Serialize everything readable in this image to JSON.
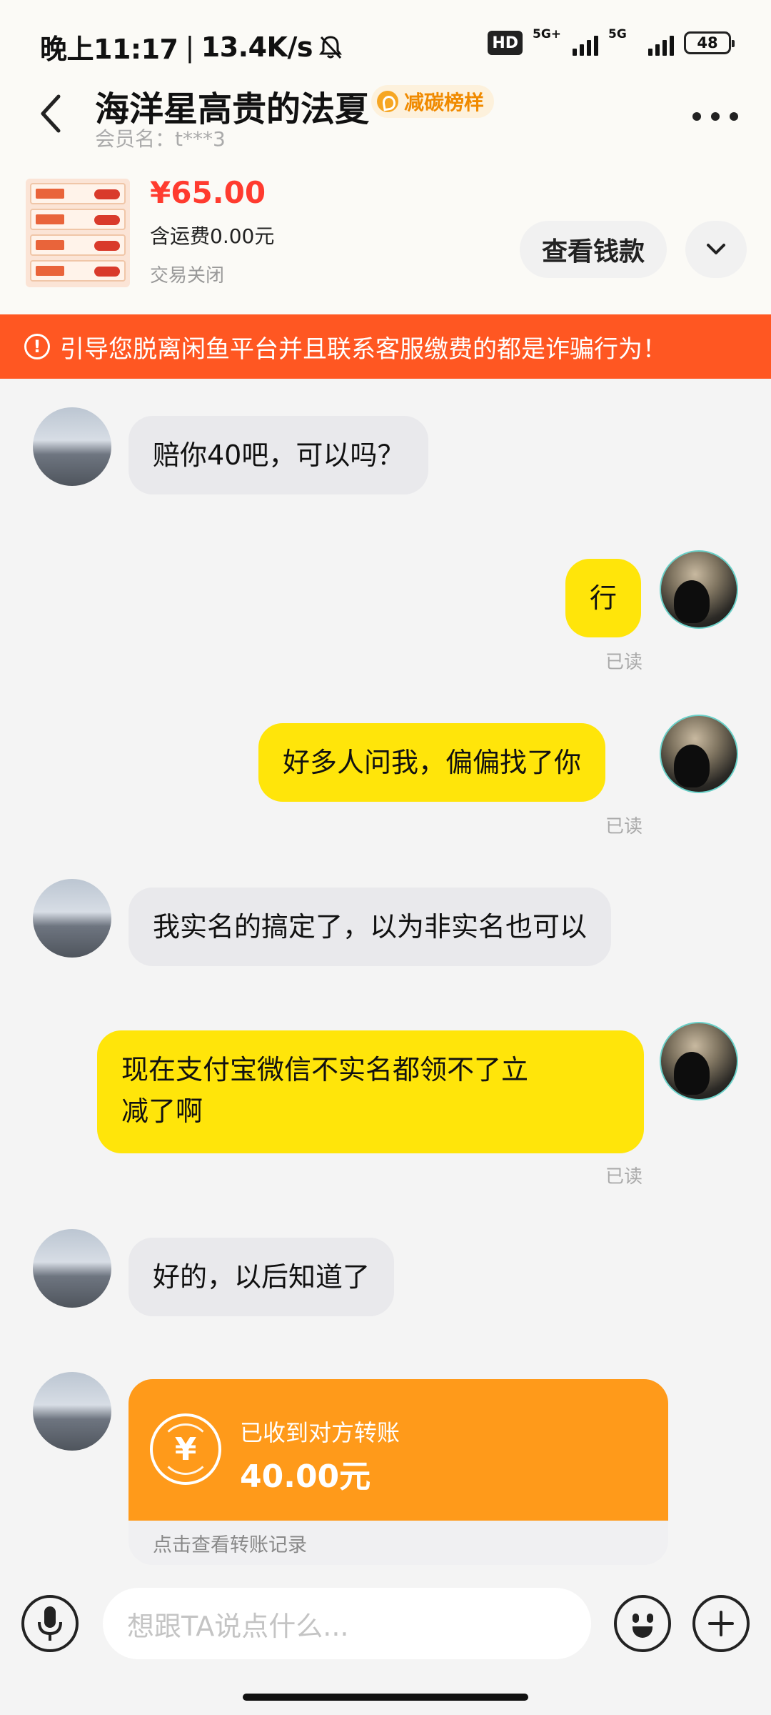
{
  "status_bar": {
    "time": "晚上11:17",
    "net_speed": "13.4K/s",
    "hd_label": "HD",
    "sim1_label": "5G+",
    "sim2_label": "5G",
    "battery": "48",
    "icons": [
      "bell-off-icon",
      "signal-icon",
      "battery-icon"
    ]
  },
  "header": {
    "title": "海洋星高贵的法夏",
    "badge": "减碳榜样",
    "member": "会员名：t***3"
  },
  "product": {
    "price": "¥65.00",
    "shipping": "含运费0.00元",
    "status": "交易关闭",
    "view_button": "查看钱款"
  },
  "warning": {
    "text": "引导您脱离闲鱼平台并且联系客服缴费的都是诈骗行为！"
  },
  "messages": [
    {
      "from": "them",
      "text": "赔你40吧，可以吗？"
    },
    {
      "from": "me",
      "text": "行",
      "read": "已读"
    },
    {
      "from": "me",
      "text": "好多人问我，偏偏找了你",
      "read": "已读"
    },
    {
      "from": "them",
      "text": "我实名的搞定了，以为非实名也可以"
    },
    {
      "from": "me",
      "text_line1": "现在支付宝微信不实名都领不了立",
      "text_line2": "减了啊",
      "read": "已读"
    },
    {
      "from": "them",
      "text": "好的，以后知道了"
    }
  ],
  "transfer": {
    "title": "已收到对方转账",
    "amount": "40.00元",
    "link": "点击查看转账记录",
    "icon": "¥"
  },
  "input": {
    "placeholder": "想跟TA说点什么..."
  },
  "colors": {
    "accent_yellow": "#ffe50a",
    "warning_orange": "#ff5722",
    "transfer_orange": "#ff9a1a",
    "price_red": "#ff3b2f"
  }
}
